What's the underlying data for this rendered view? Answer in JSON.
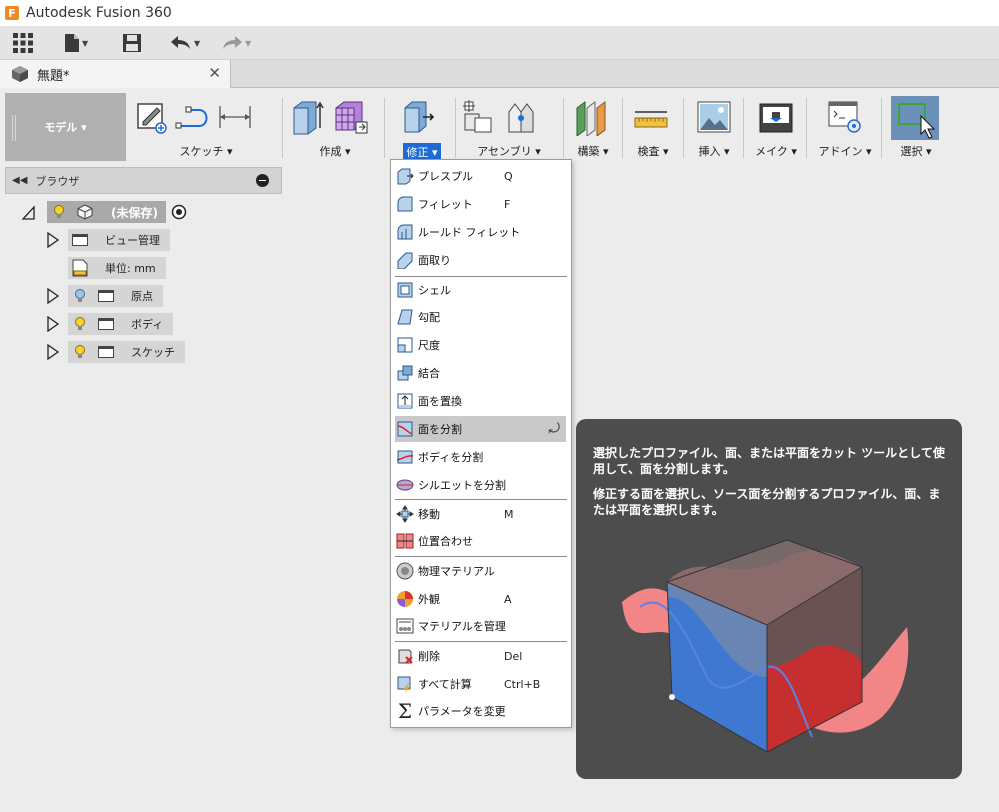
{
  "app": {
    "title": "Autodesk Fusion 360",
    "logo_letter": "F"
  },
  "document": {
    "tab_name": "無題*",
    "close_glyph": "✕"
  },
  "workspace": {
    "label": "モデル ▾"
  },
  "toolbar": {
    "groups": [
      {
        "label": "スケッチ ▾"
      },
      {
        "label": "作成 ▾"
      },
      {
        "label": "修正 ▾"
      },
      {
        "label": "アセンブリ ▾"
      },
      {
        "label": "構築 ▾"
      },
      {
        "label": "検査 ▾"
      },
      {
        "label": "挿入 ▾"
      },
      {
        "label": "メイク ▾"
      },
      {
        "label": "アドイン ▾"
      },
      {
        "label": "選択 ▾"
      }
    ]
  },
  "browser": {
    "title": "ブラウザ",
    "root": "(未保存)",
    "nodes": [
      {
        "label": "ビュー管理"
      },
      {
        "label": "単位: mm"
      },
      {
        "label": "原点"
      },
      {
        "label": "ボディ"
      },
      {
        "label": "スケッチ"
      }
    ]
  },
  "menu": {
    "items": [
      {
        "label": "プレスプル",
        "key": "Q"
      },
      {
        "label": "フィレット",
        "key": "F"
      },
      {
        "label": "ルールド フィレット",
        "key": ""
      },
      {
        "label": "面取り",
        "key": ""
      },
      {
        "label": "シェル",
        "key": ""
      },
      {
        "label": "勾配",
        "key": ""
      },
      {
        "label": "尺度",
        "key": ""
      },
      {
        "label": "結合",
        "key": ""
      },
      {
        "label": "面を置換",
        "key": ""
      },
      {
        "label": "面を分割",
        "key": ""
      },
      {
        "label": "ボディを分割",
        "key": ""
      },
      {
        "label": "シルエットを分割",
        "key": ""
      },
      {
        "label": "移動",
        "key": "M"
      },
      {
        "label": "位置合わせ",
        "key": ""
      },
      {
        "label": "物理マテリアル",
        "key": ""
      },
      {
        "label": "外観",
        "key": "A"
      },
      {
        "label": "マテリアルを管理",
        "key": ""
      },
      {
        "label": "削除",
        "key": "Del"
      },
      {
        "label": "すべて計算",
        "key": "Ctrl+B"
      },
      {
        "label": "パラメータを変更",
        "key": ""
      }
    ]
  },
  "tooltip": {
    "line1": "選択したプロファイル、面、または平面をカット ツールとして使用して、面を分割します。",
    "line2": "修正する面を選択し、ソース面を分割するプロファイル、面、または平面を選択します。"
  },
  "colors": {
    "accent": "#1e6bd6",
    "tooltip_bg": "#4d4d4d",
    "workspace_bg": "#b0b0b0",
    "highlight": "#c9c9c9"
  }
}
